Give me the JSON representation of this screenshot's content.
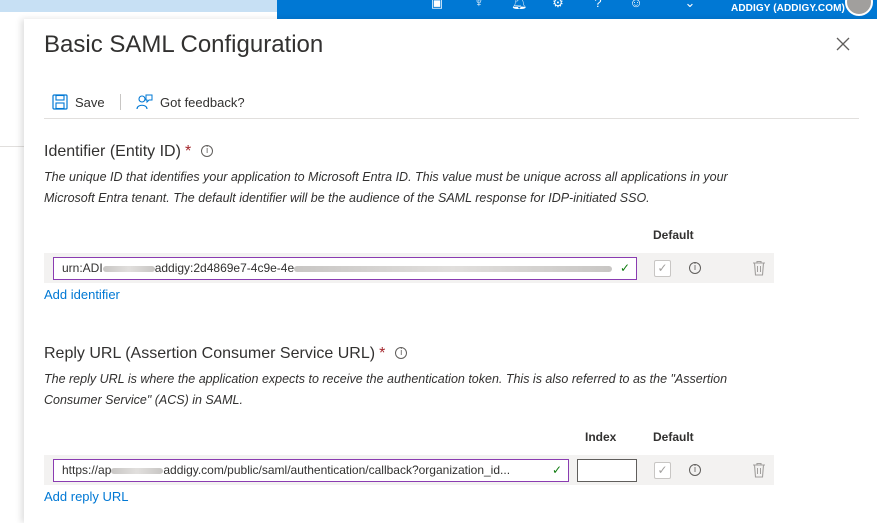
{
  "header": {
    "org_label": "ADDIGY (ADDIGY.COM)",
    "icons": [
      "feedback-icon",
      "bell-icon",
      "notifications-icon",
      "gear-icon",
      "help-icon",
      "person-icon",
      "chevron-down-icon"
    ]
  },
  "blade": {
    "title": "Basic SAML Configuration",
    "toolbar": {
      "save_label": "Save",
      "feedback_label": "Got feedback?"
    },
    "identifier": {
      "title": "Identifier (Entity ID)",
      "required_mark": "*",
      "description": "The unique ID that identifies your application to Microsoft Entra ID. This value must be unique across all applications in your Microsoft Entra tenant. The default identifier will be the audience of the SAML response for IDP-initiated SSO.",
      "default_header": "Default",
      "value_prefix": "urn:ADI",
      "value_middle": "addigy:2d4869e7-4c9e-4e",
      "add_link": "Add identifier"
    },
    "reply_url": {
      "title": "Reply URL (Assertion Consumer Service URL)",
      "required_mark": "*",
      "description": "The reply URL is where the application expects to receive the authentication token. This is also referred to as the \"Assertion Consumer Service\" (ACS) in SAML.",
      "index_header": "Index",
      "default_header": "Default",
      "value_prefix": "https://ap",
      "value_suffix": "addigy.com/public/saml/authentication/callback?organization_id...",
      "index_value": "",
      "add_link": "Add reply URL"
    }
  }
}
